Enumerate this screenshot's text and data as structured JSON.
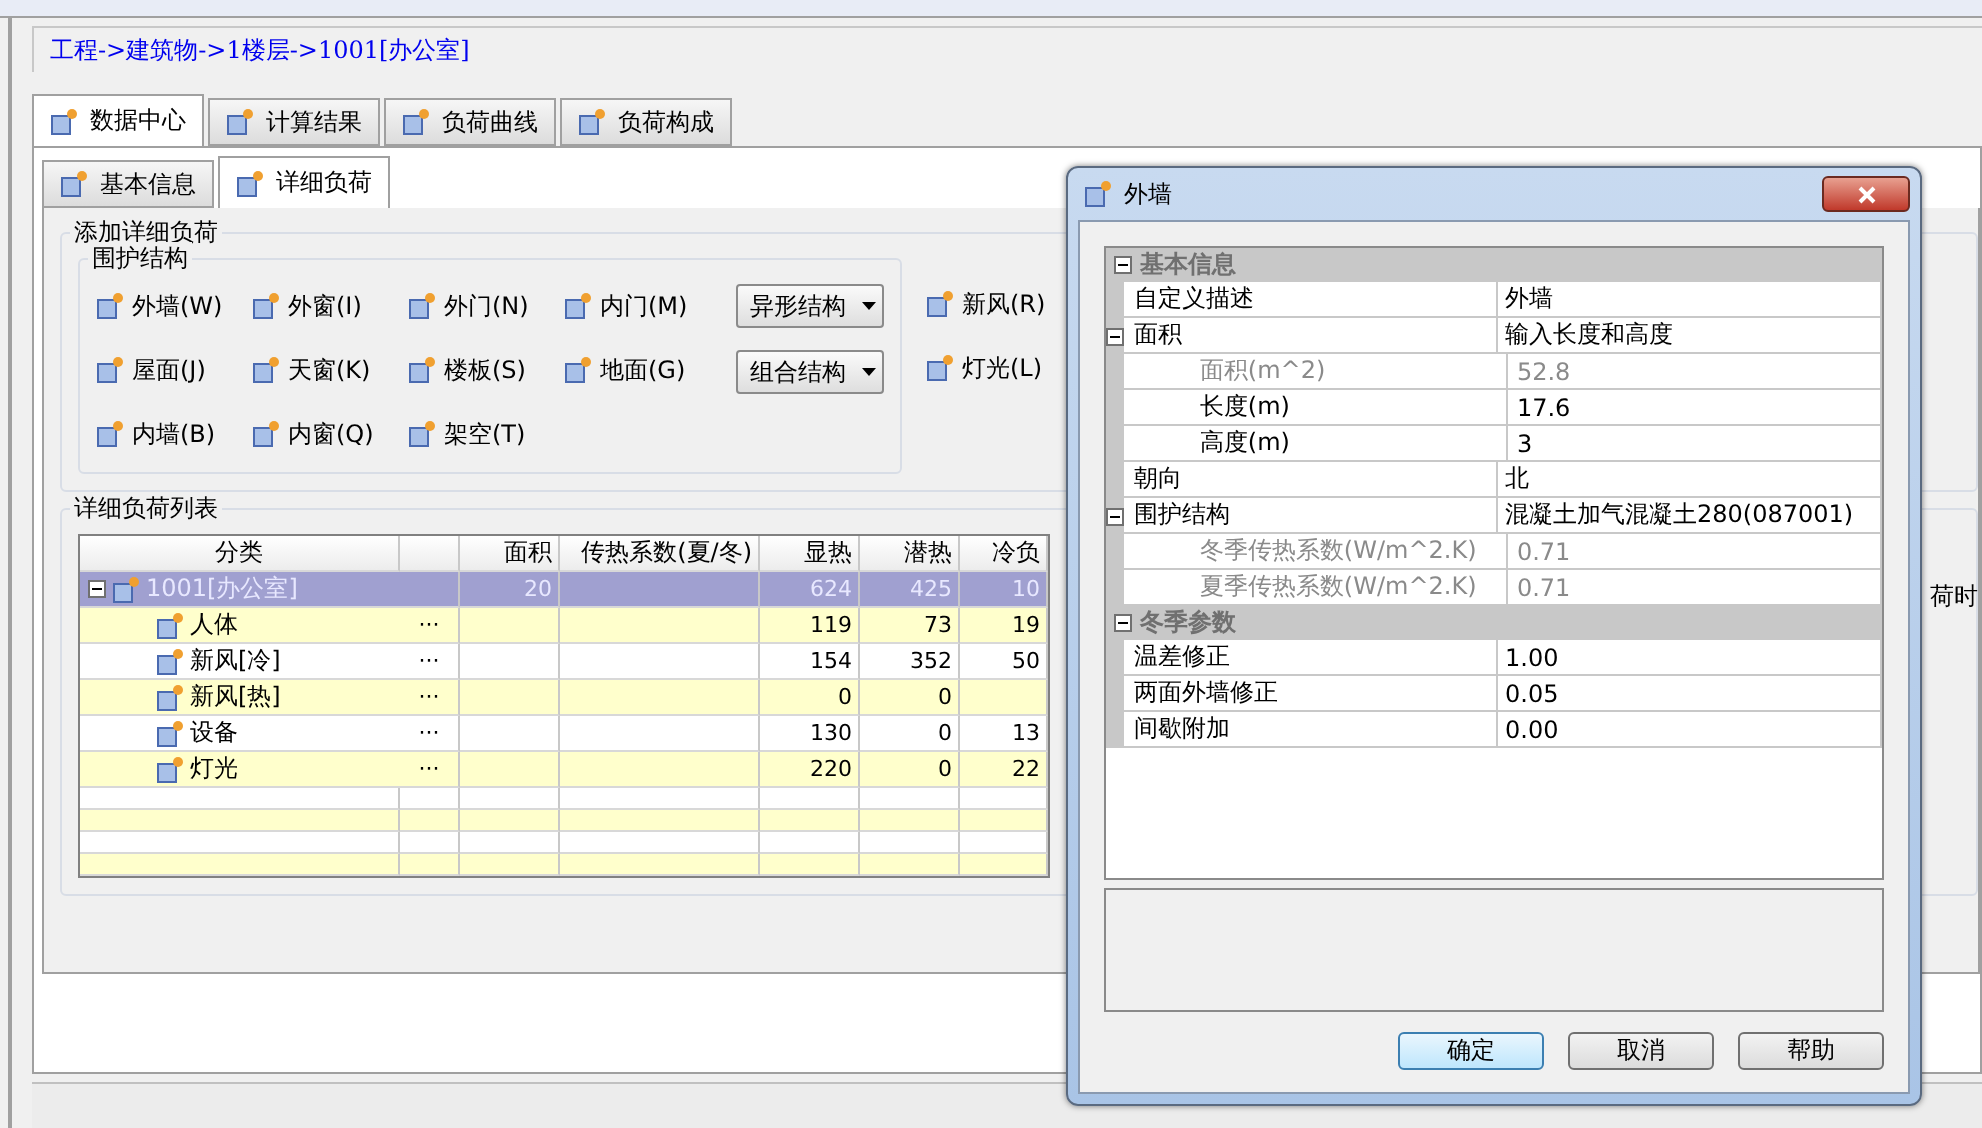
{
  "breadcrumb": "工程->建筑物->1楼层->1001[办公室]",
  "main_tabs": [
    {
      "label": "数据中心",
      "selected": true
    },
    {
      "label": "计算结果",
      "selected": false
    },
    {
      "label": "负荷曲线",
      "selected": false
    },
    {
      "label": "负荷构成",
      "selected": false
    }
  ],
  "sub_tabs": [
    {
      "label": "基本信息",
      "selected": false
    },
    {
      "label": "详细负荷",
      "selected": true
    }
  ],
  "add_group": {
    "title": "添加详细负荷",
    "envelope": {
      "title": "围护结构",
      "items": [
        "外墙(W)",
        "外窗(I)",
        "外门(N)",
        "内门(M)",
        "屋面(J)",
        "天窗(K)",
        "楼板(S)",
        "地面(G)",
        "内墙(B)",
        "内窗(Q)",
        "架空(T)"
      ],
      "dropdowns": [
        "异形结构",
        "组合结构"
      ]
    },
    "other_items": [
      "新风(R)",
      "灯光(L)"
    ]
  },
  "load_list": {
    "title": "详细负荷列表",
    "columns": [
      "分类",
      "",
      "面积",
      "传热系数(夏/冬)",
      "显热",
      "潜热",
      "冷负"
    ],
    "right_column": "荷时",
    "rows": [
      {
        "cells": [
          "1001[办公室]",
          "",
          "20",
          "",
          "624",
          "425",
          "10"
        ],
        "selected": true,
        "expanded": true,
        "children": [
          {
            "cells": [
              "人体",
              "···",
              "",
              "",
              "119",
              "73",
              "19"
            ],
            "selected": false
          },
          {
            "cells": [
              "新风[冷]",
              "···",
              "",
              "",
              "154",
              "352",
              "50"
            ],
            "selected": false
          },
          {
            "cells": [
              "新风[热]",
              "···",
              "",
              "",
              "0",
              "0",
              ""
            ],
            "selected": false
          },
          {
            "cells": [
              "设备",
              "···",
              "",
              "",
              "130",
              "0",
              "13"
            ],
            "selected": false
          },
          {
            "cells": [
              "灯光",
              "···",
              "",
              "",
              "220",
              "0",
              "22"
            ],
            "selected": false
          }
        ]
      }
    ]
  },
  "dialog": {
    "title": "外墙",
    "sections": [
      {
        "title": "基本信息",
        "expanded": true,
        "rows": [
          {
            "label": "自定义描述",
            "value": "外墙",
            "disabled": false
          },
          {
            "label": "面积",
            "value": "输入长度和高度",
            "disabled": false,
            "expanded": true,
            "children": [
              {
                "label": "面积(m^2)",
                "value": "52.8",
                "disabled": true
              },
              {
                "label": "长度(m)",
                "value": "17.6",
                "disabled": false
              },
              {
                "label": "高度(m)",
                "value": "3",
                "disabled": false
              }
            ]
          },
          {
            "label": "朝向",
            "value": "北",
            "disabled": false
          },
          {
            "label": "围护结构",
            "value": "混凝土加气混凝土280(087001)",
            "disabled": false,
            "expanded": true,
            "children": [
              {
                "label": "冬季传热系数(W/m^2.K)",
                "value": "0.71",
                "disabled": true
              },
              {
                "label": "夏季传热系数(W/m^2.K)",
                "value": "0.71",
                "disabled": true
              }
            ]
          }
        ]
      },
      {
        "title": "冬季参数",
        "expanded": true,
        "rows": [
          {
            "label": "温差修正",
            "value": "1.00",
            "disabled": false
          },
          {
            "label": "两面外墙修正",
            "value": "0.05",
            "disabled": false
          },
          {
            "label": "间歇附加",
            "value": "0.00",
            "disabled": false
          }
        ]
      }
    ],
    "buttons": [
      {
        "label": "确定",
        "default": true
      },
      {
        "label": "取消",
        "default": false
      },
      {
        "label": "帮助",
        "default": false
      }
    ]
  }
}
